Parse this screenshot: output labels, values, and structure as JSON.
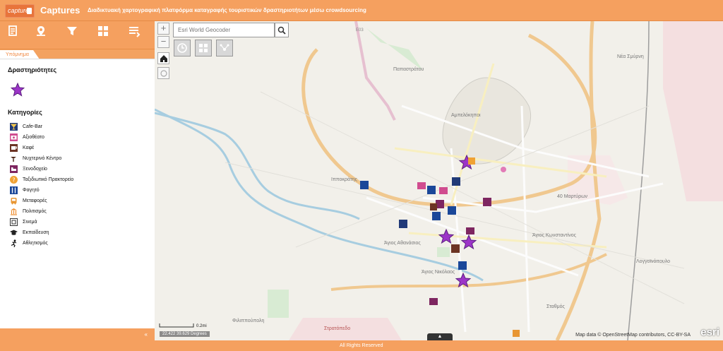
{
  "header": {
    "logo_text": "captures",
    "title": "Captures",
    "subtitle": "Διαδικτυακή χαρτογραφική πλατφόρμα καταγραφής τουριστικών δραστηριοτήτων μέσω crowdsourcing"
  },
  "toolbar": {
    "items": [
      {
        "name": "records",
        "icon": "document-list-icon"
      },
      {
        "name": "location",
        "icon": "location-pin-icon"
      },
      {
        "name": "filter",
        "icon": "filter-icon"
      },
      {
        "name": "basemap",
        "icon": "grid-icon"
      },
      {
        "name": "layers",
        "icon": "list-layers-icon"
      }
    ]
  },
  "legend": {
    "tab_label": "Υπόμνημα",
    "activities_heading": "Δραστηριότητες",
    "categories_heading": "Κατηγορίες",
    "categories": [
      {
        "label": "Cafe-Bar",
        "icon": "cocktail-icon",
        "color": "#213a78"
      },
      {
        "label": "Αξιοθέατο",
        "icon": "camera-icon",
        "color": "#d04c8f"
      },
      {
        "label": "Καφέ",
        "icon": "coffee-icon",
        "color": "#6c3424"
      },
      {
        "label": "Νυχτερινό Κέντρο",
        "icon": "nightclub-icon",
        "color": "#532e1f"
      },
      {
        "label": "Ξενοδοχείο",
        "icon": "bed-icon",
        "color": "#7e2660"
      },
      {
        "label": "Ταξιδιωτικό Πρακτορείο",
        "icon": "question-icon",
        "color": "#f0a234"
      },
      {
        "label": "Φαγητό",
        "icon": "restaurant-icon",
        "color": "#1a4799"
      },
      {
        "label": "Μεταφορές",
        "icon": "bus-icon",
        "color": "#e89633"
      },
      {
        "label": "Πολιτισμός",
        "icon": "museum-icon",
        "color": "#ee8c2c"
      },
      {
        "label": "Σινεμά",
        "icon": "cinema-icon",
        "color": "#333333"
      },
      {
        "label": "Εκπαίδευση",
        "icon": "graduation-cap-icon",
        "color": "#222222"
      },
      {
        "label": "Αθλητισμός",
        "icon": "runner-icon",
        "color": "#111111"
      }
    ]
  },
  "map": {
    "search_placeholder": "Esri World Geocoder",
    "scale_label": "0.2mi",
    "coordinates": "22.422 39.629 Degrees",
    "attribution": "Map data © OpenStreetMap contributors, CC-BY-SA",
    "esri_logo": "esri",
    "zoom_in": "+",
    "zoom_out": "−",
    "labels": {
      "papastratos": "Παπαστράτου",
      "ampelokipoi": "Αμπελόκηποι",
      "ippokratis": "Ιπποκράτης",
      "nea_smyrni": "Νέα Σμύρνη",
      "martyron": "40 Μαρτύρων",
      "ag_konstantinos": "Άγιος Κωνσταντίνος",
      "agios_athanasios": "Άγιος Αθανάσιος",
      "agios_nikolaos": "Άγιος Νικόλαος",
      "larissa_area": "Λογγοϊνόπουλο",
      "filippoupoli": "Φιλιππούπολη",
      "stathmos": "Σταθμός",
      "stratopedo": "Στρατόπεδο",
      "e03": "E03"
    }
  },
  "footer": {
    "collapse": "«",
    "bottom_tab": "▲",
    "rights": "All Rights Reserved"
  },
  "colors": {
    "accent": "#f5a05f",
    "marker_purple": "#9c35c8",
    "marker_navy": "#213a78"
  }
}
